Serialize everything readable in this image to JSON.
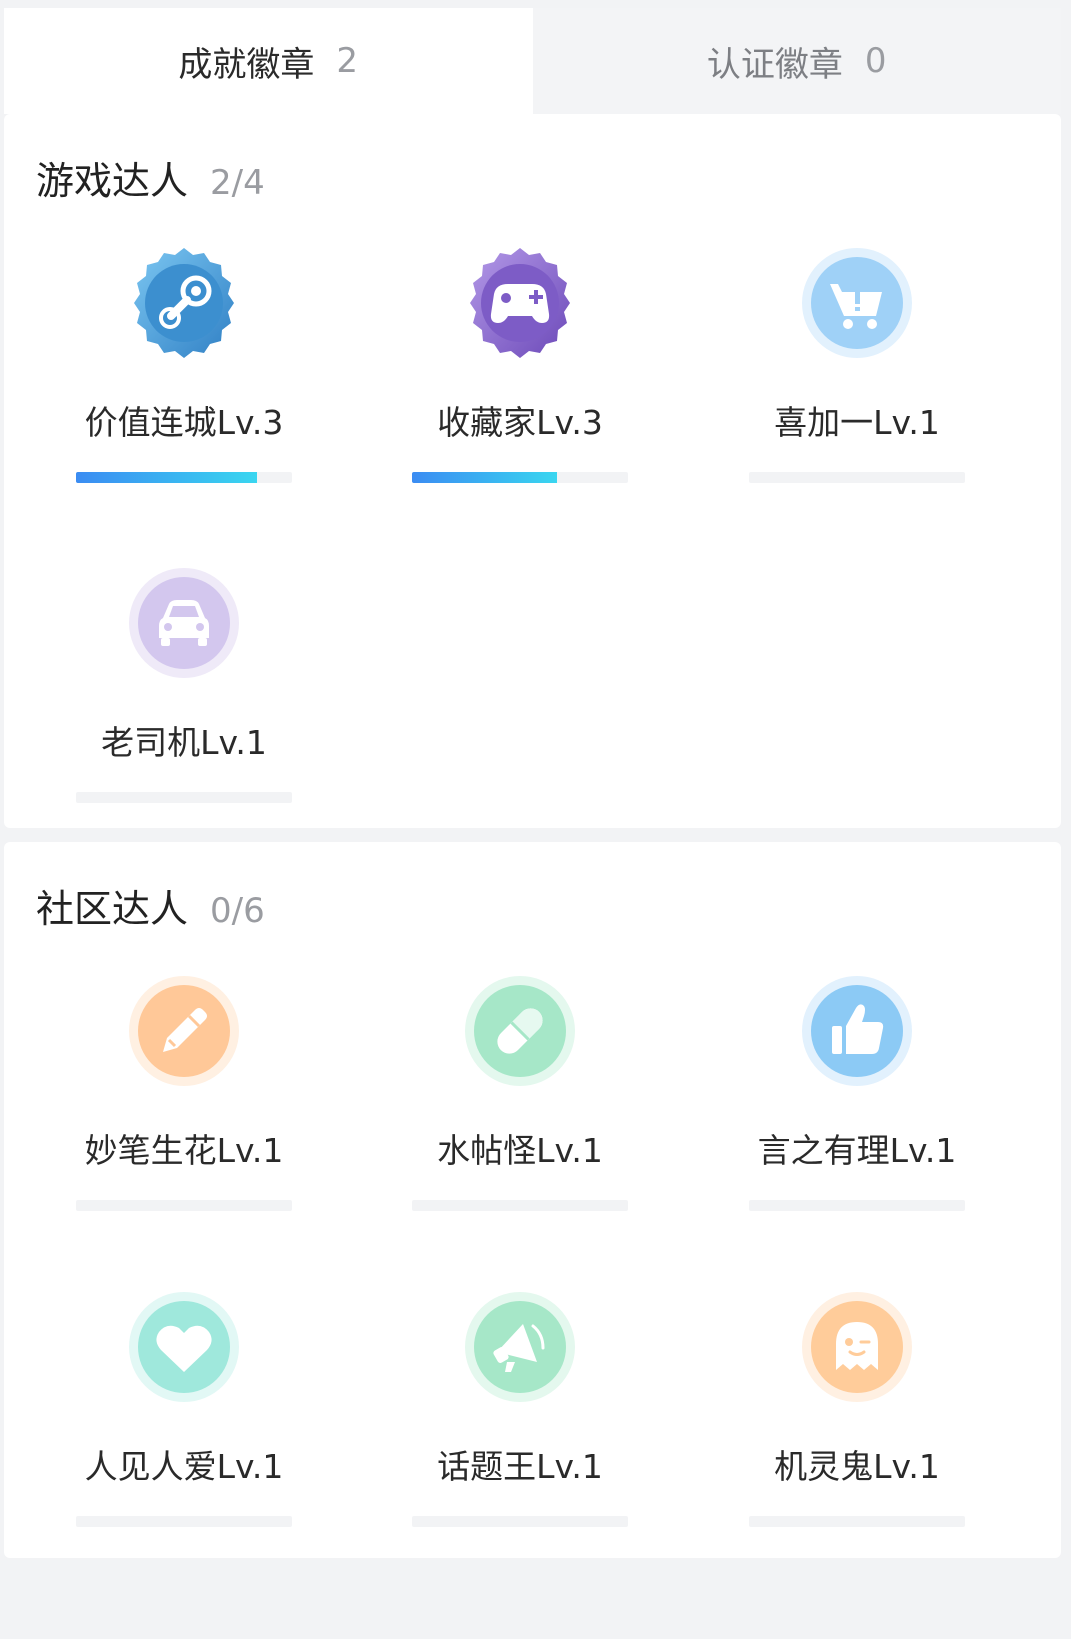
{
  "tabs": [
    {
      "label": "成就徽章",
      "count": "2",
      "active": true
    },
    {
      "label": "认证徽章",
      "count": "0",
      "active": false
    }
  ],
  "sections": [
    {
      "title": "游戏达人",
      "progress": "2/4",
      "badges": [
        {
          "label": "价值连城Lv.3",
          "icon": "steam-icon",
          "progress": 0.84,
          "earned": true
        },
        {
          "label": "收藏家Lv.3",
          "icon": "gamepad-icon",
          "progress": 0.67,
          "earned": true
        },
        {
          "label": "喜加一Lv.1",
          "icon": "shopping-cart-icon",
          "progress": 0,
          "earned": false
        },
        {
          "label": "老司机Lv.1",
          "icon": "car-icon",
          "progress": 0,
          "earned": false
        }
      ]
    },
    {
      "title": "社区达人",
      "progress": "0/6",
      "badges": [
        {
          "label": "妙笔生花Lv.1",
          "icon": "pencil-icon",
          "progress": 0,
          "earned": false
        },
        {
          "label": "水帖怪Lv.1",
          "icon": "pill-icon",
          "progress": 0,
          "earned": false
        },
        {
          "label": "言之有理Lv.1",
          "icon": "thumbs-up-icon",
          "progress": 0,
          "earned": false
        },
        {
          "label": "人见人爱Lv.1",
          "icon": "heart-icon",
          "progress": 0,
          "earned": false
        },
        {
          "label": "话题王Lv.1",
          "icon": "megaphone-icon",
          "progress": 0,
          "earned": false
        },
        {
          "label": "机灵鬼Lv.1",
          "icon": "ghost-icon",
          "progress": 0,
          "earned": false
        }
      ]
    }
  ],
  "colors": {
    "progress_start": "#3b8cf2",
    "progress_end": "#3ad6f0",
    "steam": "#3c8fcf",
    "gamepad": "#7d5cc6",
    "cart": "#8cc8f5",
    "car": "#cfc2ea",
    "pencil": "#ffc99a",
    "pill": "#a4e6c7",
    "thumbs": "#8ccaf5",
    "heart": "#9fe8dc",
    "megaphone": "#a4e6c7",
    "ghost": "#ffcf9f"
  }
}
